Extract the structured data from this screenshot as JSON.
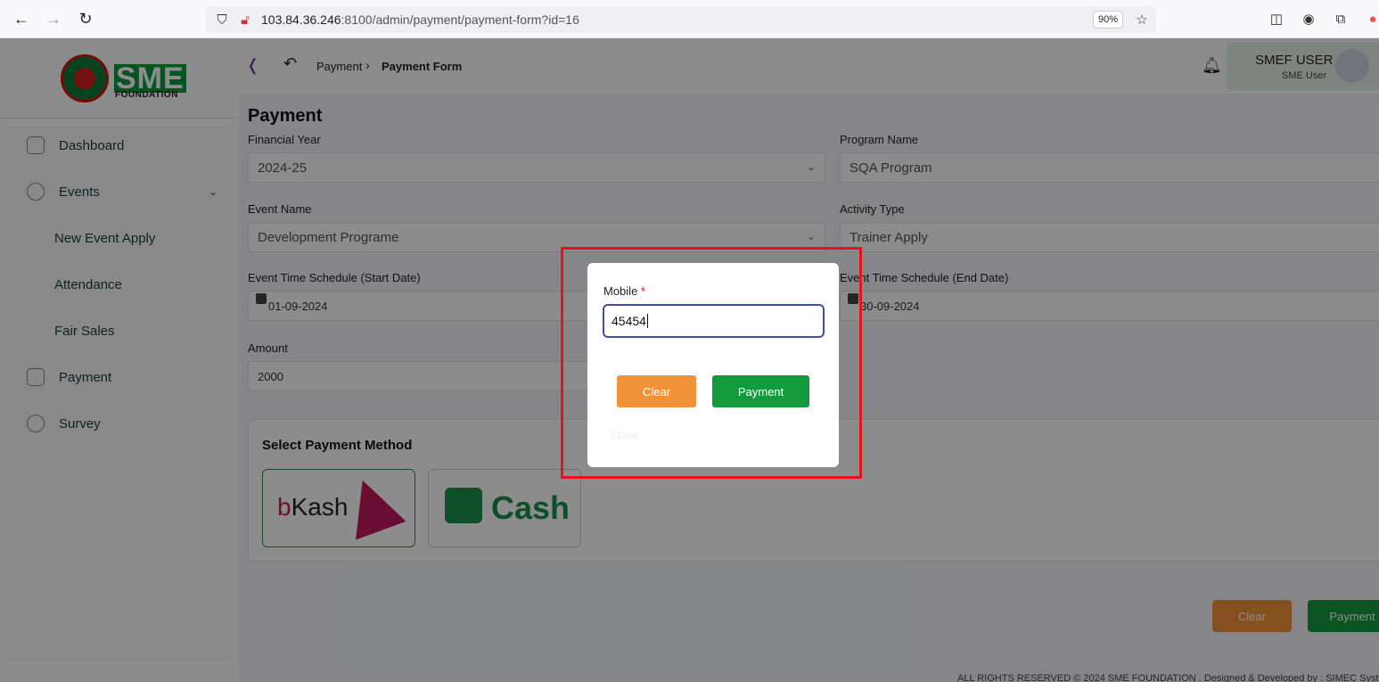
{
  "browser": {
    "url_host": "103.84.36.246",
    "url_path": ":8100/admin/payment/payment-form?id=16",
    "zoom": "90%"
  },
  "logo": {
    "brand": "SME",
    "subtitle": "FOUNDATION"
  },
  "sidebar": {
    "items": [
      {
        "label": "Dashboard",
        "icon": "grid-icon"
      },
      {
        "label": "Events",
        "icon": "events-icon"
      },
      {
        "label": "New Event Apply",
        "icon": ""
      },
      {
        "label": "Attendance",
        "icon": ""
      },
      {
        "label": "Fair Sales",
        "icon": ""
      },
      {
        "label": "Payment",
        "icon": "payment-icon"
      },
      {
        "label": "Survey",
        "icon": "survey-icon"
      }
    ]
  },
  "header": {
    "breadcrumb": [
      "Payment",
      "Payment Form"
    ],
    "user_name": "SMEF USER",
    "user_role": "SME User"
  },
  "form": {
    "title": "Payment",
    "financial_year_label": "Financial Year",
    "financial_year": "2024-25",
    "program_name_label": "Program Name",
    "program_name": "SQA Program",
    "event_name_label": "Event Name",
    "event_name": "Development Programe",
    "activity_type_label": "Activity Type",
    "activity_type": "Trainer Apply",
    "start_date_label": "Event Time Schedule (Start Date)",
    "start_date": "01-09-2024",
    "end_date_label": "Event Time Schedule (End Date)",
    "end_date": "30-09-2024",
    "amount_label": "Amount",
    "amount": "2000",
    "payment_method_title": "Select Payment Method",
    "bkash_label_b": "b",
    "bkash_label_rest": "Kash",
    "cash_label": "Cash",
    "clear_label": "Clear",
    "payment_label": "Payment"
  },
  "footer": {
    "text": "ALL RIGHTS RESERVED © 2024 SME FOUNDATION . Designed & Developed by : SIMEC Syst"
  },
  "modal": {
    "mobile_label": "Mobile",
    "required_mark": "*",
    "mobile_value": "45454",
    "clear_label": "Clear",
    "payment_label": "Payment",
    "close_label": "Close"
  },
  "colors": {
    "accent_green": "#149a3d",
    "accent_orange": "#f0923a",
    "highlight_red": "#e5141b"
  }
}
